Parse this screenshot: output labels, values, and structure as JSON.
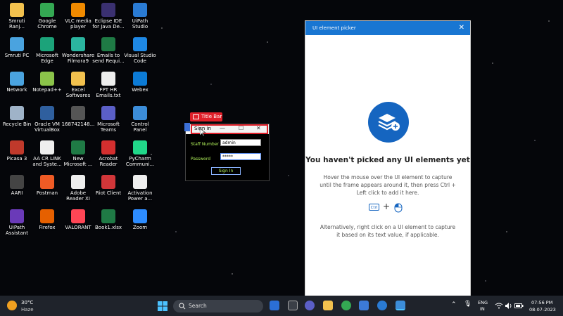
{
  "desktop_icons": [
    {
      "label": "Smruti\nRanj...",
      "icon": "folder-icon",
      "color": "#f2c14e"
    },
    {
      "label": "Google\nChrome",
      "icon": "chrome-icon",
      "color": "#34a853"
    },
    {
      "label": "VLC media\nplayer",
      "icon": "vlc-icon",
      "color": "#f08a00"
    },
    {
      "label": "Eclipse IDE\nfor Java De...",
      "icon": "eclipse-icon",
      "color": "#3a3070"
    },
    {
      "label": "UiPath\nStudio",
      "icon": "uipath-icon",
      "color": "#2a7bd4"
    },
    {
      "label": "Smruti PC",
      "icon": "pc-icon",
      "color": "#4aa3df"
    },
    {
      "label": "Microsoft\nEdge",
      "icon": "edge-icon",
      "color": "#1ca37a"
    },
    {
      "label": "Wondershare\nFilmora9",
      "icon": "filmora-icon",
      "color": "#2bb5a0"
    },
    {
      "label": "Emails to\nsend Requi...",
      "icon": "excel-icon",
      "color": "#1f7a45"
    },
    {
      "label": "Visual Studio\nCode",
      "icon": "vscode-icon",
      "color": "#1e88e5"
    },
    {
      "label": "Network",
      "icon": "network-icon",
      "color": "#4aa3df"
    },
    {
      "label": "Notepad++",
      "icon": "notepad-icon",
      "color": "#8bc34a"
    },
    {
      "label": "Excel\nSoftwares",
      "icon": "folder-icon",
      "color": "#f2c14e"
    },
    {
      "label": "FPT HR\nEmails.txt",
      "icon": "text-file-icon",
      "color": "#eeeeee"
    },
    {
      "label": "Webex",
      "icon": "webex-icon",
      "color": "#0c7bd6"
    },
    {
      "label": "Recycle Bin",
      "icon": "recycle-bin-icon",
      "color": "#9fb3c8"
    },
    {
      "label": "Oracle VM\nVirtualBox",
      "icon": "virtualbox-icon",
      "color": "#2f5f9e"
    },
    {
      "label": "168742148...",
      "icon": "image-file-icon",
      "color": "#555555"
    },
    {
      "label": "Microsoft\nTeams",
      "icon": "teams-icon",
      "color": "#5b5fc7"
    },
    {
      "label": "Control\nPanel",
      "icon": "control-panel-icon",
      "color": "#3c8dd9"
    },
    {
      "label": "Picasa 3",
      "icon": "picasa-icon",
      "color": "#c0392b"
    },
    {
      "label": "AA CR LINK\nand Syste...",
      "icon": "text-file-icon",
      "color": "#eeeeee"
    },
    {
      "label": "New\nMicrosoft ...",
      "icon": "excel-icon",
      "color": "#1f7a45"
    },
    {
      "label": "Acrobat\nReader",
      "icon": "acrobat-icon",
      "color": "#d32f2f"
    },
    {
      "label": "PyCharm\nCommuni...",
      "icon": "pycharm-icon",
      "color": "#21d789"
    },
    {
      "label": "AARI",
      "icon": "aari-icon",
      "color": "#444444"
    },
    {
      "label": "Postman",
      "icon": "postman-icon",
      "color": "#ef5b25"
    },
    {
      "label": "Adobe\nReader XI",
      "icon": "text-file-icon",
      "color": "#eeeeee"
    },
    {
      "label": "Riot Client",
      "icon": "riot-icon",
      "color": "#d13639"
    },
    {
      "label": "Activation\nPower a...",
      "icon": "text-file-icon",
      "color": "#eeeeee"
    },
    {
      "label": "UiPath\nAssistant",
      "icon": "uipath-assistant-icon",
      "color": "#6a3ab8"
    },
    {
      "label": "Firefox",
      "icon": "firefox-icon",
      "color": "#e66000"
    },
    {
      "label": "VALORANT",
      "icon": "valorant-icon",
      "color": "#ff4655"
    },
    {
      "label": "Book1.xlsx",
      "icon": "excel-icon",
      "color": "#1f7a45"
    },
    {
      "label": "Zoom",
      "icon": "zoom-icon",
      "color": "#2d8cff"
    }
  ],
  "signin_app": {
    "title": "Sign in",
    "staff_label": "Staff Number",
    "staff_value": "admin",
    "password_label": "Password",
    "password_value": "*****",
    "button": "Sign In",
    "accent": "#b0f05a"
  },
  "highlight_tag": {
    "label": "Title Bar",
    "color": "#e0202a"
  },
  "picker": {
    "header": "UI element picker",
    "title": "You haven't picked any UI elements yet",
    "instruction": "Hover the mouse over the UI element to capture until the frame appears around it, then press Ctrl + Left click to add it here.",
    "key_label": "Ctrl",
    "alternative": "Alternatively, right click on a UI element to capture it based on its text value, if applicable.",
    "accent": "#1976d2"
  },
  "taskbar": {
    "temperature": "30°C",
    "condition": "Haze",
    "search_placeholder": "Search",
    "language_line1": "ENG",
    "language_line2": "IN",
    "time": "07:56 PM",
    "date": "08-07-2023"
  }
}
